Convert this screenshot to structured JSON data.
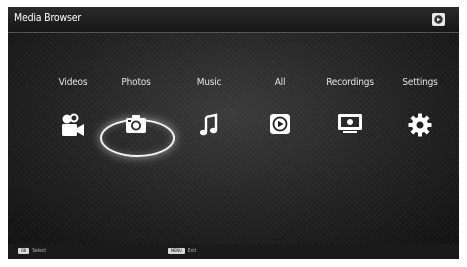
{
  "header": {
    "title": "Media Browser",
    "icon": "source-icon"
  },
  "menu": {
    "items": [
      {
        "label": "Videos",
        "icon": "video-camera-icon"
      },
      {
        "label": "Photos",
        "icon": "photo-camera-icon",
        "selected": true
      },
      {
        "label": "Music",
        "icon": "music-note-icon"
      },
      {
        "label": "All",
        "icon": "play-icon"
      },
      {
        "label": "Recordings",
        "icon": "tv-record-icon"
      },
      {
        "label": "Settings",
        "icon": "gear-icon"
      }
    ]
  },
  "footer": {
    "select": {
      "key": "OK",
      "label": "Select"
    },
    "exit": {
      "key": "MENU",
      "label": "Exit"
    }
  }
}
